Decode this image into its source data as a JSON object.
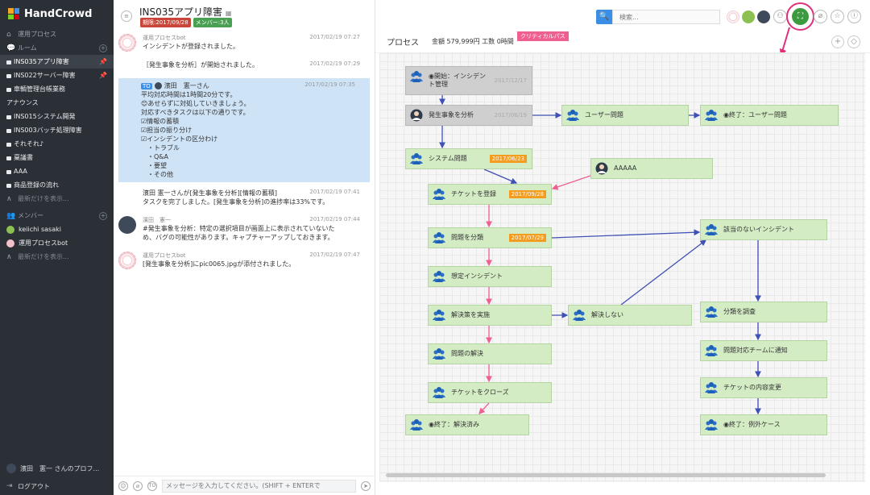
{
  "app": {
    "name": "HandCrowd"
  },
  "sidebar": {
    "ops_label": "運用プロセス",
    "rooms_label": "ルーム",
    "rooms": [
      {
        "label": "INS035アプリ障害",
        "active": true,
        "pinned": true
      },
      {
        "label": "INS022サーバー障害",
        "active": false,
        "pinned": true
      },
      {
        "label": "車輌管理台帳業務",
        "active": false,
        "pinned": false
      },
      {
        "label": "アナウンス",
        "active": false,
        "pinned": false,
        "nolock": true
      },
      {
        "label": "INS015システム開発",
        "active": false,
        "pinned": false
      },
      {
        "label": "INS003バッチ処理障害",
        "active": false,
        "pinned": false
      },
      {
        "label": "それそれ♪",
        "active": false,
        "pinned": false
      },
      {
        "label": "稟議書",
        "active": false,
        "pinned": false
      },
      {
        "label": "AAA",
        "active": false,
        "pinned": false
      },
      {
        "label": "商品登録の流れ",
        "active": false,
        "pinned": false
      }
    ],
    "rooms_more": "最新だけを表示...",
    "members_label": "メンバー",
    "members": [
      {
        "label": "keiichi sasaki",
        "color": "#8cc152"
      },
      {
        "label": "運用プロセスbot",
        "color": "#f3c1c9"
      }
    ],
    "members_more": "最新だけを表示...",
    "profile": "濱田　憲一 さんのプロフ...",
    "logout": "ログアウト"
  },
  "room": {
    "title": "INS035アプリ障害",
    "deadline": "期限:2017/09/28",
    "members": "メンバー:3人"
  },
  "messages": [
    {
      "kind": "bot",
      "sender": "運用プロセスbot",
      "time": "2017/02/19 07:27",
      "body": "インシデントが登録されました。"
    },
    {
      "kind": "plain",
      "sender": "",
      "time": "2017/02/19 07:29",
      "body": "［発生事象を分析］が開始されました。"
    },
    {
      "kind": "highlight",
      "to": "TO",
      "sender": "濱田　憲一さん",
      "time": "2017/02/19 07:35",
      "body": "平均対応時間は1時間20分です。\n😊あせらずに対処していきましょう。\n対応すべきタスクは以下の通りです。\n☑情報の蓄積\n☑担当の振り分け\n☑インシデントの区分わけ\n　・トラブル\n　・Q&A\n　・要望\n　・その他"
    },
    {
      "kind": "plain",
      "sender": "",
      "time": "2017/02/19 07:41",
      "body": "濱田 憲一さんが[発生事象を分析][情報の蓄積]\nタスクを完了しました。[発生事象を分析]の進捗率は33%です。"
    },
    {
      "kind": "person",
      "sender": "濱田　憲一",
      "time": "2017/02/19 07:44",
      "body": "#発生事象を分析：特定の選択項目が画面上に表示されていないた\nめ、バグの可能性があります。キャプチャーアップしておきます。"
    },
    {
      "kind": "bot",
      "sender": "運用プロセスbot",
      "time": "2017/02/19 07:47",
      "body": "[発生事象を分析]にpic0065.jpgが添付されました。"
    }
  ],
  "composer": {
    "placeholder": "メッセージを入力してください。(SHIFT + ENTERで",
    "to_label": "TO"
  },
  "search": {
    "button": "🔍",
    "placeholder": "検索..."
  },
  "process": {
    "title": "プロセス",
    "summary": "金額 579,999円 工数 0時間",
    "critical_path": "クリティカルパス",
    "nodes": [
      {
        "id": "start",
        "label": "◉開始：インシデン\nト管理",
        "date": "2017/12/17",
        "style": "gray"
      },
      {
        "id": "analyze",
        "label": "発生事象を分析",
        "date": "2017/06/19",
        "style": "gray"
      },
      {
        "id": "user_issue",
        "label": "ユーザー問題",
        "date": "",
        "style": "green"
      },
      {
        "id": "end_user",
        "label": "◉終了：ユーザー問題",
        "date": "",
        "style": "green"
      },
      {
        "id": "system_issue",
        "label": "システム問題",
        "date": "2017/06/23",
        "style": "green"
      },
      {
        "id": "aaaaa",
        "label": "AAAAA",
        "date": "",
        "style": "green"
      },
      {
        "id": "ticket_reg",
        "label": "チケットを登録",
        "date": "2017/09/28",
        "style": "green"
      },
      {
        "id": "classify",
        "label": "問題を分類",
        "date": "2017/07/29",
        "style": "green"
      },
      {
        "id": "no_incident",
        "label": "該当のないインシデント",
        "date": "",
        "style": "green"
      },
      {
        "id": "assumed",
        "label": "想定インシデント",
        "date": "",
        "style": "green"
      },
      {
        "id": "implement",
        "label": "解決策を実施",
        "date": "",
        "style": "green"
      },
      {
        "id": "not_solved",
        "label": "解決しない",
        "date": "",
        "style": "green"
      },
      {
        "id": "investigate",
        "label": "分類を調査",
        "date": "",
        "style": "green"
      },
      {
        "id": "solved_problem",
        "label": "問題の解決",
        "date": "",
        "style": "green"
      },
      {
        "id": "notify_team",
        "label": "問題対応チームに通知",
        "date": "",
        "style": "green"
      },
      {
        "id": "close_ticket",
        "label": "チケットをクローズ",
        "date": "",
        "style": "green"
      },
      {
        "id": "change_ticket",
        "label": "チケットの内容変更",
        "date": "",
        "style": "green"
      },
      {
        "id": "end_solved",
        "label": "◉終了：解決済み",
        "date": "",
        "style": "green"
      },
      {
        "id": "end_exception",
        "label": "◉終了：例外ケース",
        "date": "",
        "style": "green"
      }
    ]
  },
  "colors": {
    "accent": "#3a8ee6",
    "critical": "#ef5f90",
    "edge": "#3f51b5",
    "node": "#d4ecc4"
  }
}
